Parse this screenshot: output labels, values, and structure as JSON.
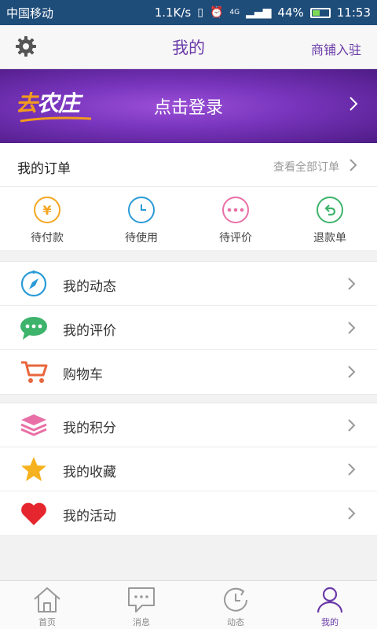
{
  "status_bar": {
    "carrier": "中国移动",
    "net_speed": "1.1K/s",
    "network": "4G",
    "battery": "44%",
    "time": "11:53"
  },
  "header": {
    "title": "我的",
    "shop_entry": "商铺入驻"
  },
  "banner": {
    "logo_text_1": "去",
    "logo_text_2": "农庄",
    "login_label": "点击登录"
  },
  "orders": {
    "title": "我的订单",
    "view_all": "查看全部订单",
    "items": [
      {
        "label": "待付款",
        "icon": "yen-icon",
        "color": "#f5a623"
      },
      {
        "label": "待使用",
        "icon": "clock-icon",
        "color": "#2a9bd7"
      },
      {
        "label": "待评价",
        "icon": "more-dots-icon",
        "color": "#e870a6"
      },
      {
        "label": "退款单",
        "icon": "return-arrow-icon",
        "color": "#3db36b"
      }
    ]
  },
  "menu_group_1": [
    {
      "label": "我的动态",
      "icon": "compass-icon",
      "color": "#2a9bd7"
    },
    {
      "label": "我的评价",
      "icon": "chat-bubble-icon",
      "color": "#3db36b"
    },
    {
      "label": "购物车",
      "icon": "cart-icon",
      "color": "#e8663d"
    }
  ],
  "menu_group_2": [
    {
      "label": "我的积分",
      "icon": "layers-icon",
      "color": "#e870a6"
    },
    {
      "label": "我的收藏",
      "icon": "star-icon",
      "color": "#f5b21e"
    },
    {
      "label": "我的活动",
      "icon": "heart-icon",
      "color": "#e6262e"
    }
  ],
  "tabbar": [
    {
      "label": "首页",
      "icon": "home-icon",
      "active": false
    },
    {
      "label": "消息",
      "icon": "message-icon",
      "active": false
    },
    {
      "label": "动态",
      "icon": "refresh-clock-icon",
      "active": false
    },
    {
      "label": "我的",
      "icon": "person-icon",
      "active": true
    }
  ],
  "colors": {
    "accent": "#6a3aa8",
    "status_bar": "#1f4d7a",
    "banner": "#7a36bf"
  }
}
